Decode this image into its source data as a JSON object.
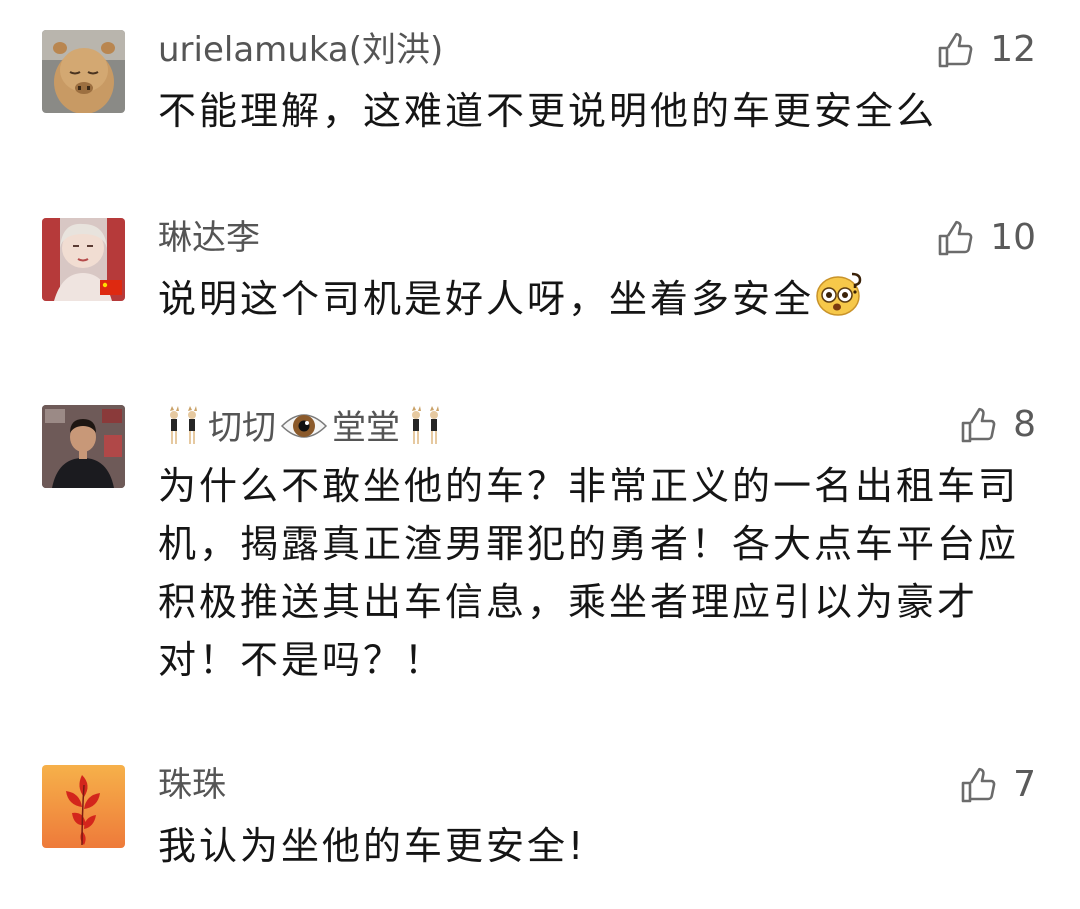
{
  "comments": [
    {
      "username": "urielamuka(刘洪)",
      "likes": "12",
      "text": "不能理解，这难道不更说明他的车更安全么",
      "avatar_icon": "capybara-avatar"
    },
    {
      "username": "琳达李",
      "likes": "10",
      "text": "说明这个司机是好人呀，坐着多安全",
      "trailing_emoji": "dizzy-face-emoji",
      "avatar_icon": "woman-portrait-avatar"
    },
    {
      "username_parts": [
        "切切",
        "堂堂"
      ],
      "username_emojis": [
        "dancers-emoji",
        "eye-emoji",
        "dancers-emoji"
      ],
      "likes": "8",
      "text": "为什么不敢坐他的车？非常正义的一名出租车司机，揭露真正渣男罪犯的勇者！各大点车平台应积极推送其出车信息，乘坐者理应引以为豪才对！不是吗？！",
      "avatar_icon": "man-portrait-avatar"
    },
    {
      "username": "珠珠",
      "likes": "7",
      "text": "我认为坐他的车更安全!",
      "avatar_icon": "red-flower-avatar"
    }
  ],
  "colors": {
    "text": "#151515",
    "username": "#555555",
    "like": "#6b6b6b",
    "background": "#ffffff"
  }
}
